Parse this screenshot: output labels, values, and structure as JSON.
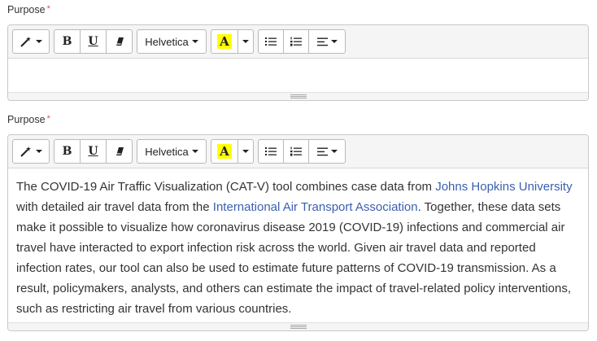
{
  "editors": [
    {
      "label": "Purpose",
      "required_mark": "*",
      "toolbar": {
        "magic_icon": "magic-wand-icon",
        "bold": "B",
        "underline": "U",
        "eraser_icon": "eraser-icon",
        "font_name": "Helvetica",
        "color_letter": "A",
        "unordered_list_icon": "unordered-list-icon",
        "ordered_list_icon": "ordered-list-icon",
        "paragraph_icon": "align-left-icon"
      },
      "content": null
    },
    {
      "label": "Purpose",
      "required_mark": "*",
      "toolbar": {
        "magic_icon": "magic-wand-icon",
        "bold": "B",
        "underline": "U",
        "eraser_icon": "eraser-icon",
        "font_name": "Helvetica",
        "color_letter": "A",
        "unordered_list_icon": "unordered-list-icon",
        "ordered_list_icon": "ordered-list-icon",
        "paragraph_icon": "align-left-icon"
      },
      "content": {
        "t1": "The COVID-19 Air Traffic Visualization (CAT-V) tool combines case data from ",
        "link1": "Johns Hopkins University",
        "t2": " with detailed air travel data from the ",
        "link2": "International Air Transport Association",
        "t3": ". Together, these data sets make it possible to visualize how coronavirus disease 2019 (COVID-19) infections and commercial air travel have interacted to export infection risk across the world. Given air travel data and reported infection rates, our tool can also be used to estimate future patterns of COVID-19 transmission. As a result, policymakers, analysts, and others can estimate the impact of travel-related policy interventions, such as restricting air travel from various countries."
      }
    }
  ],
  "colors": {
    "required": "#d9534f",
    "link": "#3a5fb0",
    "highlight": "#ffff00",
    "toolbar_bg": "#f5f5f5"
  }
}
